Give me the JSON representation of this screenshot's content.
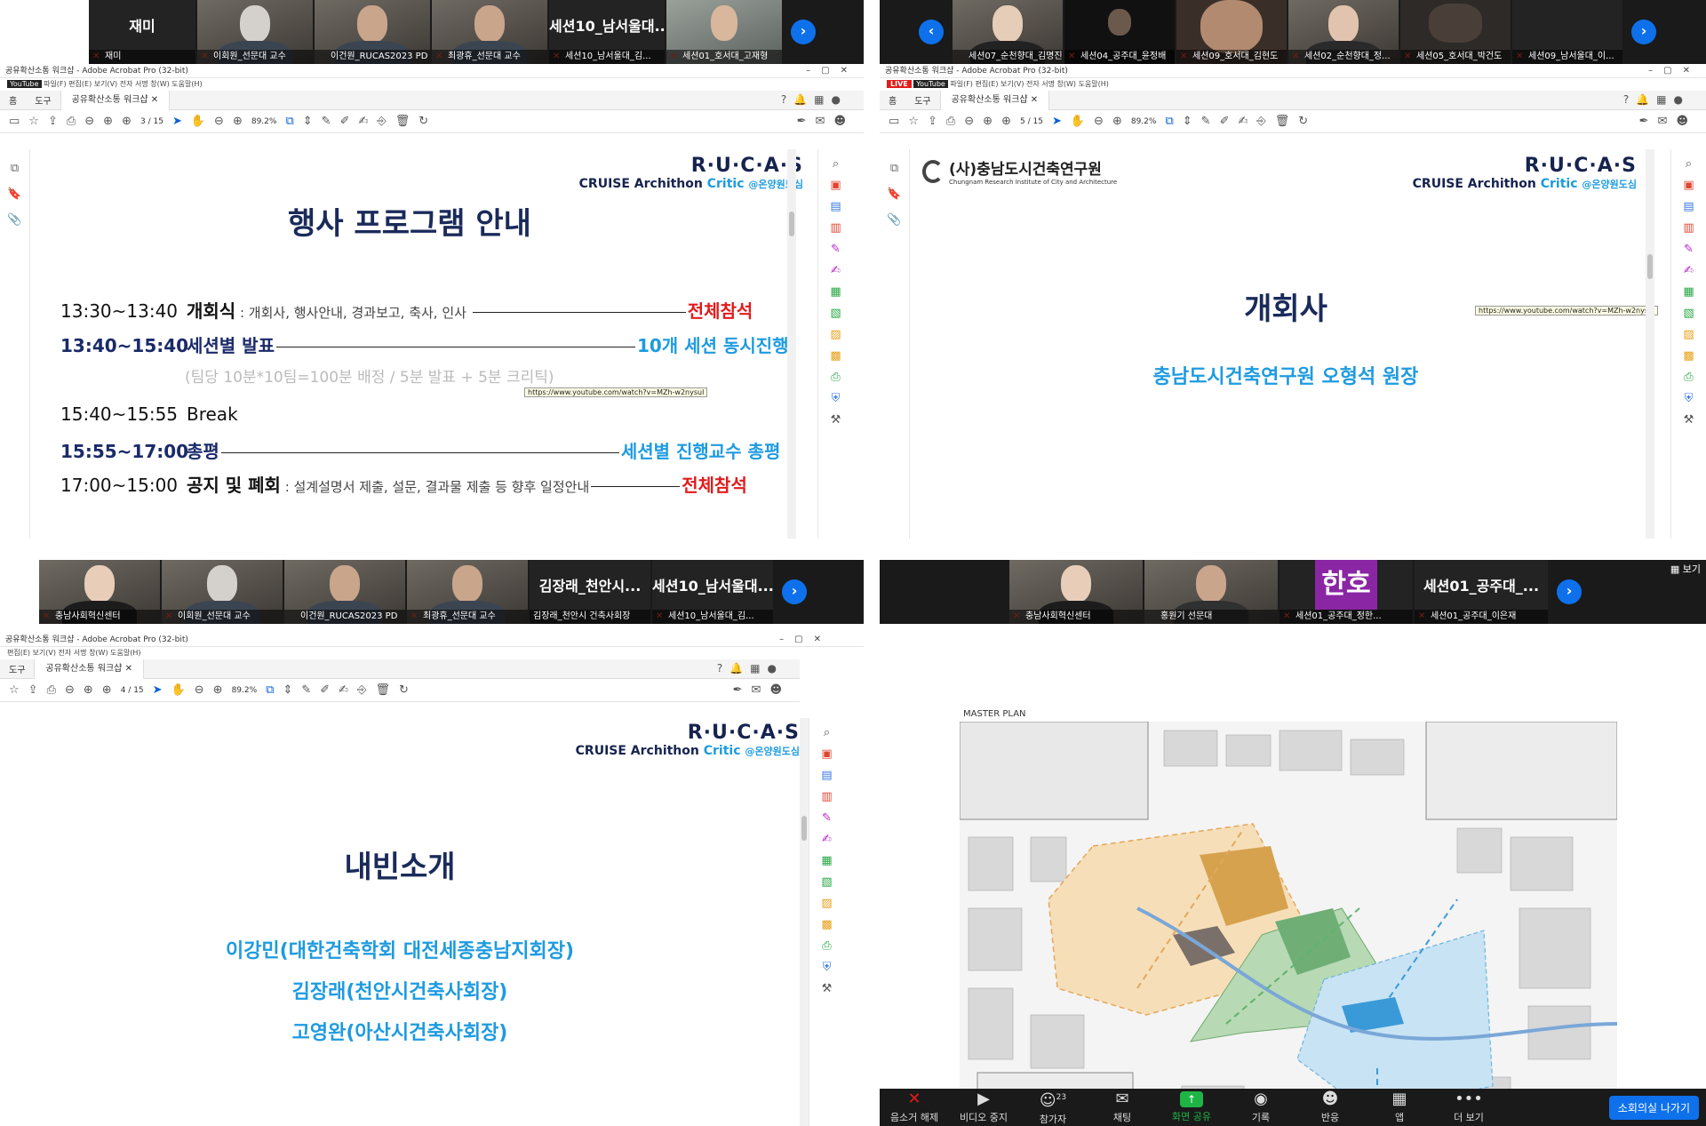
{
  "q1": {
    "strip": {
      "tiles": [
        {
          "big": "재미",
          "name": "재미"
        },
        {
          "name": "이회원_선문대 교수"
        },
        {
          "name": "이건원_RUCAS2023 PD"
        },
        {
          "name": "최광휴_선문대 교수"
        },
        {
          "big": "세션10_남서울대...",
          "name": "세션10_남서울대_김..."
        },
        {
          "name": "세션01_호서대_고재형"
        }
      ]
    },
    "acrobat": {
      "window_title": "공유확산소통 워크샵 - Adobe Acrobat Pro (32-bit)",
      "yt": "YouTube",
      "menu": "파일(F)  편집(E)  보기(V)  전자 서명  창(W)  도움말(H)",
      "nav_home": "홈",
      "nav_tools": "도구",
      "tab": "공유확산소통 워크샵",
      "page": "3",
      "pages": "/ 15",
      "zoom": "89.2%"
    },
    "slide": {
      "rucas": "R·U·C·A·S",
      "cruise": "CRUISE Archithon ",
      "critic": "Critic ",
      "tag": "@온양원도심",
      "title": "행사 프로그램 안내",
      "rows": [
        {
          "time": "13:30~13:40",
          "name": "개회식",
          "desc": " : 개회사, 행사안내, 경과보고, 축사, 인사 ",
          "right": "전체참석"
        },
        {
          "time": "13:40~15:40",
          "name": "세션별 발표",
          "right": "10개 세션 동시진행"
        },
        {
          "sub": "(팀당 10분*10팀=100분 배정 / 5분 발표 + 5분 크리틱)"
        },
        {
          "time": "15:40~15:55",
          "name": "Break"
        },
        {
          "time": "15:55~17:00",
          "name": "총평",
          "right": "세션별 진행교수 총평"
        },
        {
          "time": "17:00~15:00",
          "name": "공지 및 폐회",
          "desc": " : 설계설명서 제출, 설문, 결과물 제출 등 향후 일정안내",
          "right": "전체참석"
        }
      ],
      "tooltip": "https://www.youtube.com/watch?v=MZh-w2nysul"
    }
  },
  "q2": {
    "strip": {
      "tiles": [
        {
          "name": "세션07_순천향대_김명진"
        },
        {
          "name": "세션04_공주대_윤정배"
        },
        {
          "name": "세션09_호서대_김현도"
        },
        {
          "name": "세션02_순천향대_정..."
        },
        {
          "name": "세션05_호서대_박건도"
        },
        {
          "name": "세션09_남서울대_이..."
        }
      ]
    },
    "acrobat": {
      "window_title": "공유확산소통 워크샵 - Adobe Acrobat Pro (32-bit)",
      "live": "LIVE",
      "yt": "YouTube",
      "menu": "파일(F)  편집(E)  보기(V)  전자 서명  창(W)  도움말(H)",
      "nav_home": "홈",
      "nav_tools": "도구",
      "tab": "공유확산소통 워크샵",
      "page": "5",
      "pages": "/ 15",
      "zoom": "89.2%"
    },
    "slide": {
      "org": "(사)충남도시건축연구원",
      "org_en": "Chungnam Research Institute of City and Architecture",
      "rucas": "R·U·C·A·S",
      "cruise": "CRUISE Archithon ",
      "critic": "Critic ",
      "tag": "@온양원도심",
      "title": "개회사",
      "speaker": "충남도시건축연구원 오형석 원장",
      "tooltip": "https://www.youtube.com/watch?v=MZh-w2nysul"
    }
  },
  "q3": {
    "strip": {
      "tiles": [
        {
          "name": "충남사회혁신센터"
        },
        {
          "name": "이회원_선문대 교수"
        },
        {
          "name": "이건원_RUCAS2023 PD"
        },
        {
          "name": "최광휴_선문대 교수"
        },
        {
          "big": "김장래_천안시...",
          "name": "김장래_천안시 건축사회장"
        },
        {
          "big": "세션10_남서울대...",
          "name": "세션10_남서울대_김..."
        }
      ]
    },
    "acrobat": {
      "window_title": "공유확산소통 워크샵 - Adobe Acrobat Pro (32-bit)",
      "menu": "편집(E)  보기(V)  전자 서명  창(W)  도움말(H)",
      "nav_tools": "도구",
      "tab": "공유확산소통 워크샵",
      "page": "4",
      "pages": "/ 15",
      "zoom": "89.2%"
    },
    "slide": {
      "rucas": "R·U·C·A·S",
      "cruise": "CRUISE Archithon ",
      "critic": "Critic ",
      "tag": "@온양원도심",
      "title": "내빈소개",
      "guests": [
        "이강민(대한건축학회 대전세종충남지회장)",
        "김장래(천안시건축사회장)",
        "고영완(아산시건축사회장)"
      ]
    }
  },
  "q4": {
    "view_label": "보기",
    "strip": {
      "tiles": [
        {
          "name": "충남사회혁신센터"
        },
        {
          "name": "홍원기 선문대"
        },
        {
          "big": "한호",
          "name": "세션01_공주대_정한..."
        },
        {
          "big": "세션01_공주대_...",
          "name": "세션01_공주대_이은재"
        }
      ]
    },
    "plan_title": "MASTER PLAN",
    "controls": [
      {
        "icon": "🎤",
        "label": "음소거 해제"
      },
      {
        "icon": "▶",
        "label": "비디오 중지"
      },
      {
        "icon": "👥",
        "label": "참가자",
        "badge": "23"
      },
      {
        "icon": "💬",
        "label": "채팅"
      },
      {
        "icon": "↑",
        "label": "화면 공유"
      },
      {
        "icon": "●",
        "label": "기록"
      },
      {
        "icon": "☺",
        "label": "반응"
      },
      {
        "icon": "▦",
        "label": "앱"
      },
      {
        "icon": "•••",
        "label": "더 보기"
      }
    ],
    "leave": "소회의실 나가기"
  }
}
